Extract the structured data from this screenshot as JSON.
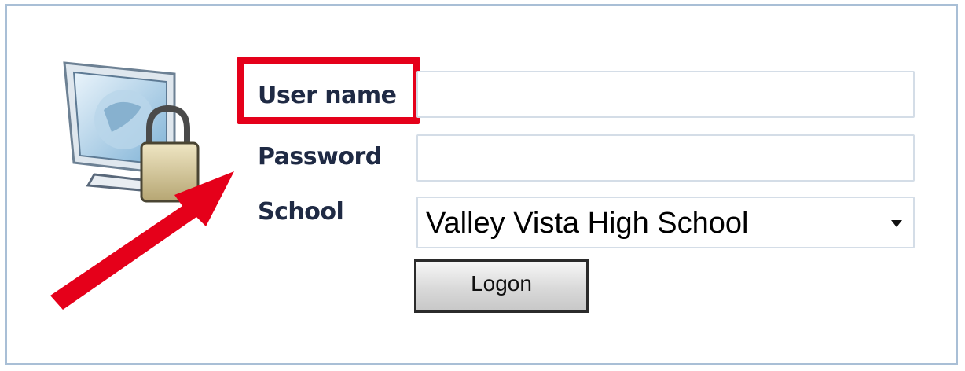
{
  "login": {
    "username_label": "User name",
    "password_label": "Password",
    "school_label": "School",
    "username_value": "",
    "password_value": "",
    "school_selected": "Valley Vista High School",
    "logon_label": "Logon"
  },
  "icons": {
    "computer": "computer-lock-icon",
    "dropdown": "chevron-down-icon",
    "annotation_arrow": "arrow-icon"
  },
  "colors": {
    "highlight": "#e5001a",
    "panel_border": "#a9bfd6",
    "label_text": "#1f2a44"
  }
}
